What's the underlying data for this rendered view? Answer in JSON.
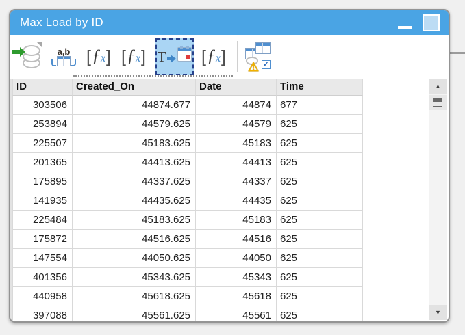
{
  "window": {
    "title": "Max Load by ID"
  },
  "titlebar": {
    "icons": [
      "minimize-icon",
      "maximize-icon"
    ]
  },
  "toolbar": {
    "tools": [
      {
        "name": "input-data",
        "icon": "database-green-arrow-icon",
        "selected": false
      },
      {
        "name": "text-to-columns",
        "icon": "ab-table-icon",
        "label": "a,b",
        "selected": false
      },
      {
        "name": "formula-1",
        "icon": "formula-fx-icon",
        "selected": false
      },
      {
        "name": "formula-2",
        "icon": "formula-fx-icon",
        "selected": false
      },
      {
        "name": "datetime",
        "icon": "t-arrow-calendar-icon",
        "label": "T",
        "selected": true
      },
      {
        "name": "formula-3",
        "icon": "formula-fx-icon",
        "selected": false
      },
      {
        "name": "browse-check",
        "icon": "tables-warning-check-icon",
        "selected": false
      }
    ]
  },
  "glyphs": {
    "bracket_open": "[",
    "bracket_close": "]",
    "f": "ƒ",
    "x": "x",
    "arrow_up": "▲",
    "arrow_down": "▼",
    "check": "✓",
    "warning": "⚠"
  },
  "table": {
    "columns": [
      {
        "label": "ID",
        "align": "right"
      },
      {
        "label": "Created_On",
        "align": "right"
      },
      {
        "label": "Date",
        "align": "right"
      },
      {
        "label": "Time",
        "align": "left"
      }
    ],
    "rows": [
      [
        "303506",
        "44874.677",
        "44874",
        "677"
      ],
      [
        "253894",
        "44579.625",
        "44579",
        "625"
      ],
      [
        "225507",
        "45183.625",
        "45183",
        "625"
      ],
      [
        "201365",
        "44413.625",
        "44413",
        "625"
      ],
      [
        "175895",
        "44337.625",
        "44337",
        "625"
      ],
      [
        "141935",
        "44435.625",
        "44435",
        "625"
      ],
      [
        "225484",
        "45183.625",
        "45183",
        "625"
      ],
      [
        "175872",
        "44516.625",
        "44516",
        "625"
      ],
      [
        "147554",
        "44050.625",
        "44050",
        "625"
      ],
      [
        "401356",
        "45343.625",
        "45343",
        "625"
      ],
      [
        "440958",
        "45618.625",
        "45618",
        "625"
      ],
      [
        "397088",
        "45561.625",
        "45561",
        "625"
      ]
    ]
  },
  "colors": {
    "titlebar": "#4aa4e4",
    "selection_fill": "#aad5f4",
    "selection_border": "#26418c",
    "header_bg": "#e9e9e9",
    "accent_blue": "#4f8fd0",
    "green_arrow": "#2e9b2e",
    "red_square": "#e03c3c",
    "warning_yellow": "#f2b200"
  }
}
